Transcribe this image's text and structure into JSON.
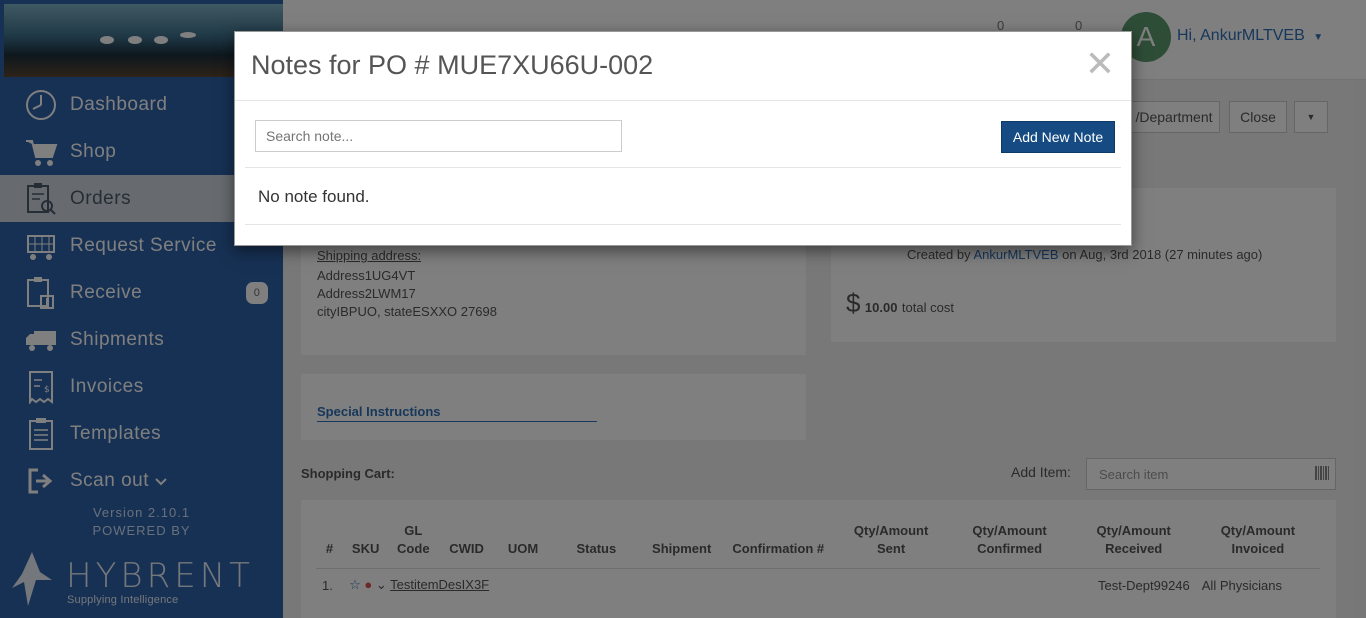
{
  "sidebar": {
    "items": [
      {
        "label": "Dashboard",
        "icon": "clock-icon"
      },
      {
        "label": "Shop",
        "icon": "cart-icon"
      },
      {
        "label": "Orders",
        "icon": "clipboard-search-icon",
        "active": true
      },
      {
        "label": "Request Service",
        "icon": "cart-grid-icon"
      },
      {
        "label": "Receive",
        "icon": "clipboard-receive-icon",
        "badge": "0"
      },
      {
        "label": "Shipments",
        "icon": "truck-icon"
      },
      {
        "label": "Invoices",
        "icon": "invoice-icon"
      },
      {
        "label": "Templates",
        "icon": "clipboard-list-icon"
      },
      {
        "label": "Scan out",
        "icon": "sign-out-icon",
        "has_chevron": true
      }
    ],
    "version": "Version 2.10.1",
    "powered_by": "POWERED BY",
    "brand": "HYBRENT",
    "brand_tagline": "Supplying Intelligence"
  },
  "header": {
    "avatar_initial": "A",
    "greeting": "Hi, AnkurMLTVEB",
    "counts": [
      "0",
      "0"
    ]
  },
  "toolbar": {
    "department_btn": "/Department",
    "close_btn": "Close"
  },
  "shipping": {
    "heading": "Shipping address:",
    "line1": "Address1UG4VT",
    "line2": "Address2LWM17",
    "line3": "cityIBPUO, stateESXXO 27698"
  },
  "summary": {
    "created_prefix": "Created by",
    "created_by": "AnkurMLTVEB",
    "created_suffix": "on Aug, 3rd 2018 (27 minutes ago)",
    "currency": "$",
    "total": "10.00",
    "total_label": "total cost"
  },
  "special_instructions": "Special Instructions",
  "cart": {
    "title": "Shopping Cart:",
    "add_item_label": "Add Item:",
    "search_placeholder": "Search item",
    "headers": [
      "#",
      "SKU",
      "GL Code",
      "CWID",
      "UOM",
      "Status",
      "Shipment",
      "Confirmation #",
      "Qty/Amount Sent",
      "Qty/Amount Confirmed",
      "Qty/Amount Received",
      "Qty/Amount Invoiced"
    ],
    "row1": {
      "num": "1.",
      "item": "TestitemDesIX3F",
      "dept": "Test-Dept99246",
      "physicians": "All Physicians"
    }
  },
  "modal": {
    "title": "Notes for PO # MUE7XU66U-002",
    "close_symbol": "✕",
    "search_placeholder": "Search note...",
    "add_button": "Add New Note",
    "empty_message": "No note found."
  }
}
